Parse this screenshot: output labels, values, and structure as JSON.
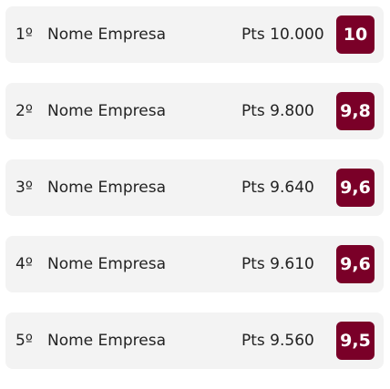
{
  "ranking": [
    {
      "position": "1º",
      "company": "Nome Empresa",
      "points": "Pts 10.000",
      "score": "10"
    },
    {
      "position": "2º",
      "company": "Nome Empresa",
      "points": "Pts 9.800",
      "score": "9,8"
    },
    {
      "position": "3º",
      "company": "Nome Empresa",
      "points": "Pts 9.640",
      "score": "9,6"
    },
    {
      "position": "4º",
      "company": "Nome Empresa",
      "points": "Pts 9.610",
      "score": "9,6"
    },
    {
      "position": "5º",
      "company": "Nome Empresa",
      "points": "Pts 9.560",
      "score": "9,5"
    }
  ],
  "colors": {
    "score_badge": "#7a0028",
    "row_background": "#f3f3f3"
  }
}
